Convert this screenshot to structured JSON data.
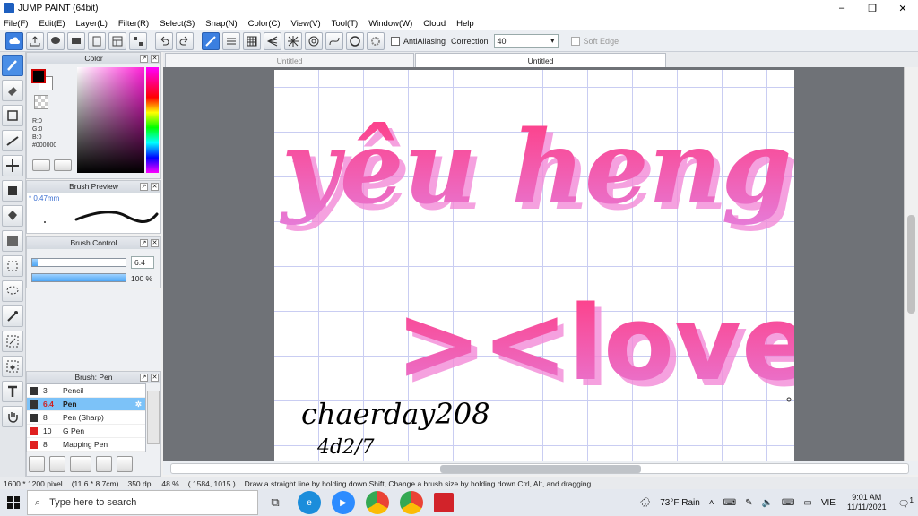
{
  "app": {
    "title": "JUMP PAINT (64bit)"
  },
  "window_controls": {
    "minimize": "–",
    "restore": "❐",
    "close": "✕"
  },
  "menu": [
    "File(F)",
    "Edit(E)",
    "Layer(L)",
    "Filter(R)",
    "Select(S)",
    "Snap(N)",
    "Color(C)",
    "View(V)",
    "Tool(T)",
    "Window(W)",
    "Cloud",
    "Help"
  ],
  "toolbar": {
    "antialias_label": "AntiAliasing",
    "correction_label": "Correction",
    "correction_value": "40",
    "soft_edge_label": "Soft Edge"
  },
  "color_panel": {
    "title": "Color",
    "r": "R:0",
    "g": "G:0",
    "b": "B:0",
    "hex": "#000000"
  },
  "brush_preview": {
    "title": "Brush Preview",
    "size": "* 0.47mm"
  },
  "brush_control": {
    "title": "Brush Control",
    "size_value": "6.4",
    "opacity_value": "100 %",
    "opacity_fraction": 1.0,
    "size_fraction": 0.06
  },
  "brush_panel": {
    "title": "Brush: Pen",
    "items": [
      {
        "size": "3",
        "name": "Pencil",
        "color": "#333333",
        "selected": false
      },
      {
        "size": "6.4",
        "name": "Pen",
        "color": "#333333",
        "selected": true
      },
      {
        "size": "8",
        "name": "Pen (Sharp)",
        "color": "#333333",
        "selected": false
      },
      {
        "size": "10",
        "name": "G Pen",
        "color": "#e02020",
        "selected": false
      },
      {
        "size": "8",
        "name": "Mapping Pen",
        "color": "#e02020",
        "selected": false
      }
    ]
  },
  "tabs": [
    "Untitled",
    "Untitled"
  ],
  "canvas": {
    "line1": "yêu heng",
    "line2": "><love",
    "signature": "chaerday208",
    "date": "4d2/7",
    "accent": "#ff4a8a"
  },
  "status": {
    "size": "1600 * 1200 pixel",
    "mm": "(11.6 * 8.7cm)",
    "dpi": "350 dpi",
    "zoom": "48 %",
    "coords": "( 1584, 1015 )",
    "hint": "Draw a straight line by holding down Shift, Change a brush size by holding down Ctrl, Alt, and dragging"
  },
  "taskbar": {
    "search_placeholder": "Type here to search",
    "weather": "73°F Rain",
    "lang": "VIE",
    "time": "9:01 AM",
    "date": "11/11/2021",
    "notif_count": "1"
  }
}
